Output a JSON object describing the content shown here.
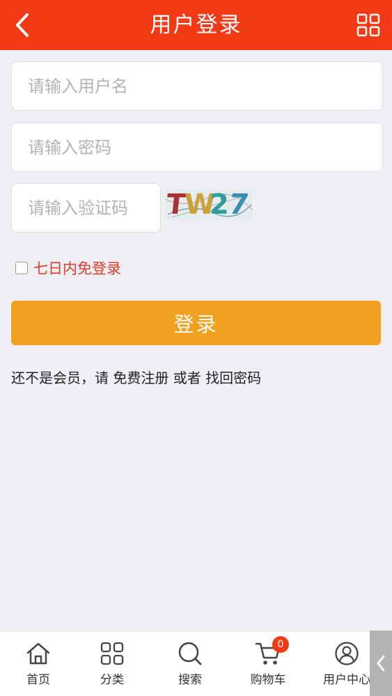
{
  "header": {
    "title": "用户登录"
  },
  "form": {
    "username_placeholder": "请输入用户名",
    "password_placeholder": "请输入密码",
    "captcha_placeholder": "请输入验证码",
    "captcha_text": [
      "T",
      "W",
      "2",
      "7"
    ],
    "remember_label": "七日内免登录",
    "login_label": "登录"
  },
  "register": {
    "prefix": "还不是会员，请",
    "register_link": "免费注册",
    "or": "或者",
    "recover_link": "找回密码"
  },
  "tabbar": {
    "items": [
      {
        "label": "首页",
        "icon": "home-icon"
      },
      {
        "label": "分类",
        "icon": "category-icon"
      },
      {
        "label": "搜索",
        "icon": "search-icon"
      },
      {
        "label": "购物车",
        "icon": "cart-icon",
        "badge": "0"
      },
      {
        "label": "用户中心",
        "icon": "user-icon"
      }
    ]
  },
  "colors": {
    "header": "#f23a17",
    "button": "#f0a11f",
    "accent_text": "#e03a2a"
  }
}
